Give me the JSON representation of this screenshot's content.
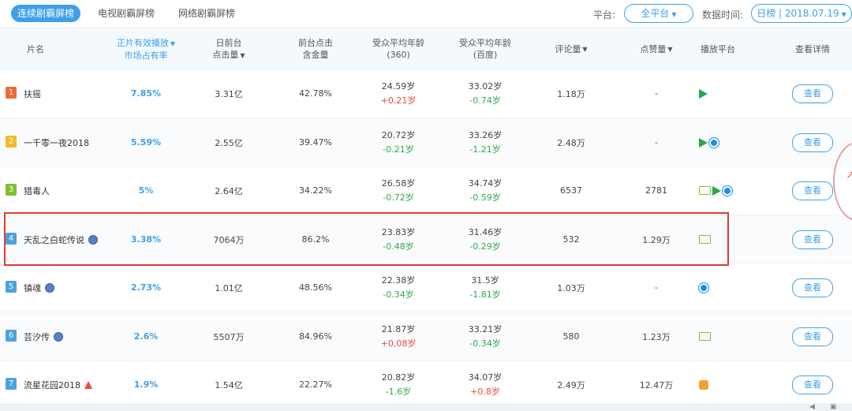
{
  "tabs": [
    {
      "label": "连续剧霸屏榜",
      "active": true
    },
    {
      "label": "电视剧霸屏榜",
      "active": false
    },
    {
      "label": "网络剧霸屏榜",
      "active": false
    }
  ],
  "filters": {
    "platform_label": "平台:",
    "platform_value": "全平台",
    "time_label": "数据时间:",
    "time_value": "日榜 | 2018.07.19"
  },
  "columns": {
    "title": "片名",
    "share_line1": "正片有效播放",
    "share_line2": "市场占有率",
    "clicks_line1": "日前台",
    "clicks_line2": "点击量",
    "gold_line1": "前台点击",
    "gold_line2": "含金量",
    "age360_line1": "受众平均年龄",
    "age360_line2": "(360)",
    "agebaidu_line1": "受众平均年龄",
    "agebaidu_line2": "(百度)",
    "comments": "评论量",
    "likes": "点赞量",
    "platforms": "播放平台",
    "details": "查看详情"
  },
  "rows": [
    {
      "rank": "1",
      "rank_color": "#f06a35",
      "title": "扶摇",
      "mark": "",
      "share": "7.85%",
      "clicks": "3.31亿",
      "gold": "42.78%",
      "age360": "24.59岁",
      "age360_delta": "+0.21岁",
      "age360_dir": "up",
      "agebaidu": "33.02岁",
      "agebaidu_delta": "-0.74岁",
      "agebaidu_dir": "down",
      "comments": "1.18万",
      "likes": "-",
      "platforms": [
        "tencent"
      ],
      "button": "查看"
    },
    {
      "rank": "2",
      "rank_color": "#f5b92a",
      "title": "一千零一夜2018",
      "mark": "",
      "share": "5.59%",
      "clicks": "2.55亿",
      "gold": "39.47%",
      "age360": "20.72岁",
      "age360_delta": "-0.21岁",
      "age360_dir": "down",
      "agebaidu": "33.26岁",
      "agebaidu_delta": "-1.21岁",
      "agebaidu_dir": "down",
      "comments": "2.48万",
      "likes": "-",
      "platforms": [
        "tencent",
        "youku"
      ],
      "button": "查看"
    },
    {
      "rank": "3",
      "rank_color": "#7cc02e",
      "title": "猎毒人",
      "mark": "",
      "share": "5%",
      "clicks": "2.64亿",
      "gold": "34.22%",
      "age360": "26.58岁",
      "age360_delta": "-0.72岁",
      "age360_dir": "down",
      "agebaidu": "34.74岁",
      "agebaidu_delta": "-0.59岁",
      "agebaidu_dir": "down",
      "comments": "6537",
      "likes": "2781",
      "platforms": [
        "iqiyi",
        "tencent",
        "youku"
      ],
      "button": "查看"
    },
    {
      "rank": "4",
      "rank_color": "#4aa3df",
      "title": "天乱之白蛇传说",
      "mark": "circle",
      "share": "3.38%",
      "clicks": "7064万",
      "gold": "86.2%",
      "age360": "23.83岁",
      "age360_delta": "-0.48岁",
      "age360_dir": "down",
      "agebaidu": "31.46岁",
      "agebaidu_delta": "-0.29岁",
      "agebaidu_dir": "down",
      "comments": "532",
      "likes": "1.29万",
      "platforms": [
        "iqiyi"
      ],
      "button": "查看"
    },
    {
      "rank": "5",
      "rank_color": "#4aa3df",
      "title": "镇魂",
      "mark": "circle",
      "share": "2.73%",
      "clicks": "1.01亿",
      "gold": "48.56%",
      "age360": "22.38岁",
      "age360_delta": "-0.34岁",
      "age360_dir": "down",
      "agebaidu": "31.5岁",
      "agebaidu_delta": "-1.81岁",
      "agebaidu_dir": "down",
      "comments": "1.03万",
      "likes": "-",
      "platforms": [
        "youku"
      ],
      "button": "查看"
    },
    {
      "rank": "6",
      "rank_color": "#4aa3df",
      "title": "芸汐传",
      "mark": "circle",
      "share": "2.6%",
      "clicks": "5507万",
      "gold": "84.96%",
      "age360": "21.87岁",
      "age360_delta": "+0.08岁",
      "age360_dir": "up",
      "agebaidu": "33.21岁",
      "agebaidu_delta": "-0.34岁",
      "agebaidu_dir": "down",
      "comments": "580",
      "likes": "1.23万",
      "platforms": [
        "iqiyi"
      ],
      "button": "查看"
    },
    {
      "rank": "7",
      "rank_color": "#4aa3df",
      "title": "流星花园2018",
      "mark": "up",
      "share": "1.9%",
      "clicks": "1.54亿",
      "gold": "22.27%",
      "age360": "20.82岁",
      "age360_delta": "-1.6岁",
      "age360_dir": "down",
      "agebaidu": "34.07岁",
      "agebaidu_delta": "+0.8岁",
      "agebaidu_dir": "up",
      "comments": "2.49万",
      "likes": "12.47万",
      "platforms": [
        "mango"
      ],
      "button": "查看"
    }
  ],
  "colors": {
    "accent": "#3ea0ea",
    "increase": "#e84a3c",
    "decrease": "#2fa84f",
    "highlight_box": "#e33a2f"
  }
}
